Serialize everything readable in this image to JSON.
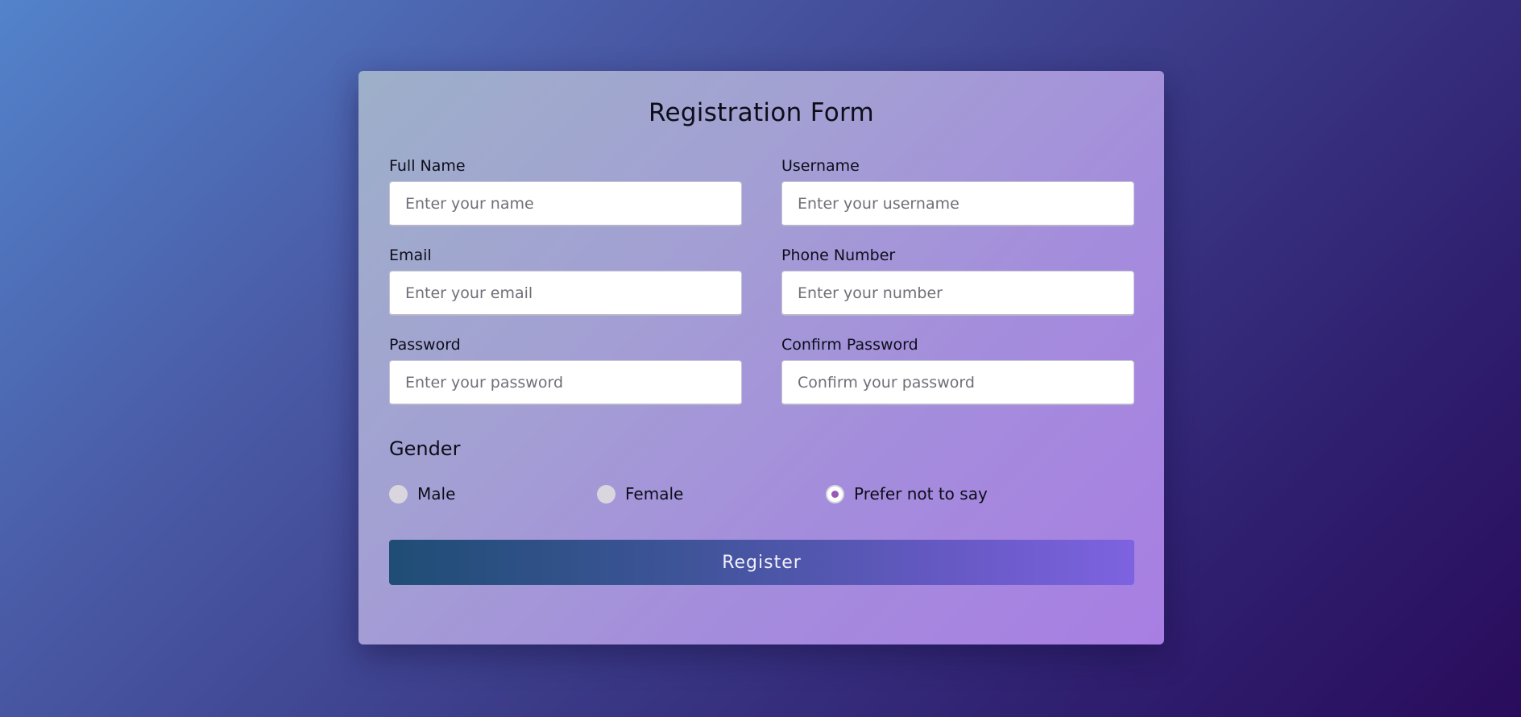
{
  "form": {
    "title": "Registration Form",
    "fields": {
      "full_name": {
        "label": "Full Name",
        "placeholder": "Enter your name",
        "value": ""
      },
      "username": {
        "label": "Username",
        "placeholder": "Enter your username",
        "value": ""
      },
      "email": {
        "label": "Email",
        "placeholder": "Enter your email",
        "value": ""
      },
      "phone": {
        "label": "Phone Number",
        "placeholder": "Enter your number",
        "value": ""
      },
      "password": {
        "label": "Password",
        "placeholder": "Enter your password",
        "value": ""
      },
      "confirm_password": {
        "label": "Confirm Password",
        "placeholder": "Confirm your password",
        "value": ""
      }
    },
    "gender": {
      "title": "Gender",
      "options": [
        {
          "label": "Male",
          "checked": false
        },
        {
          "label": "Female",
          "checked": false
        },
        {
          "label": "Prefer not to say",
          "checked": true
        }
      ]
    },
    "submit_label": "Register"
  },
  "colors": {
    "radio_checked": "#9b59b6",
    "button_gradient_start": "#1f4d75",
    "button_gradient_end": "#7d63e0"
  }
}
